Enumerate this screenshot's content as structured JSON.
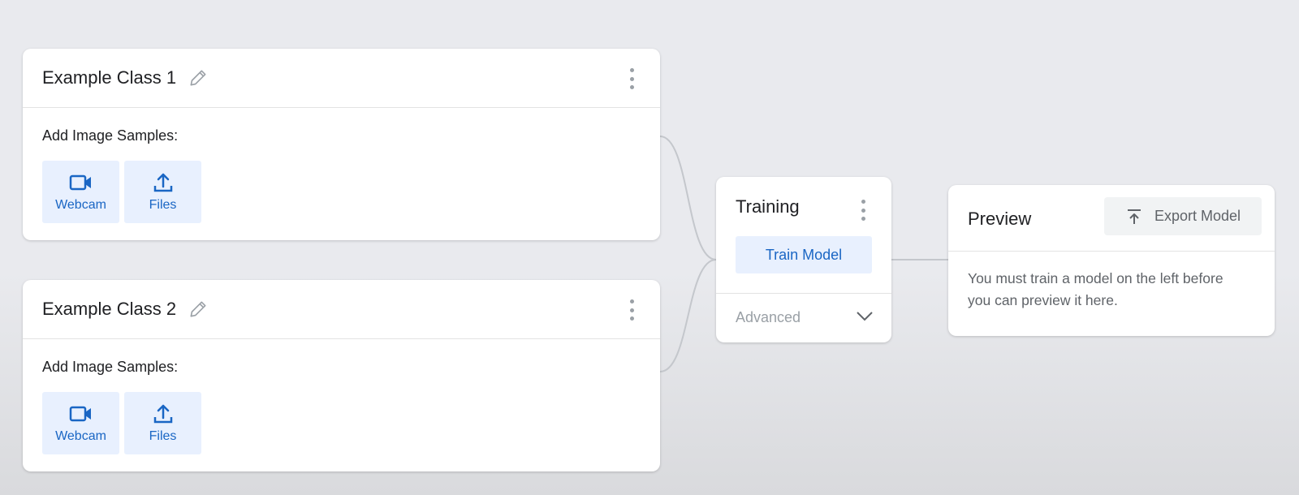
{
  "classes": [
    {
      "title": "Example Class 1",
      "samples_label": "Add Image Samples:",
      "webcam_label": "Webcam",
      "files_label": "Files"
    },
    {
      "title": "Example Class 2",
      "samples_label": "Add Image Samples:",
      "webcam_label": "Webcam",
      "files_label": "Files"
    }
  ],
  "training": {
    "title": "Training",
    "train_button": "Train Model",
    "advanced_label": "Advanced"
  },
  "preview": {
    "title": "Preview",
    "export_button": "Export Model",
    "message": "You must train a model on the left before you can preview it here."
  },
  "colors": {
    "accent": "#1a66c4",
    "button_bg": "#e8f0fe",
    "background": "#e9eaee"
  },
  "icons": [
    "pencil-icon",
    "more-vert-icon",
    "webcam-icon",
    "upload-icon",
    "chevron-down-icon",
    "export-icon"
  ]
}
